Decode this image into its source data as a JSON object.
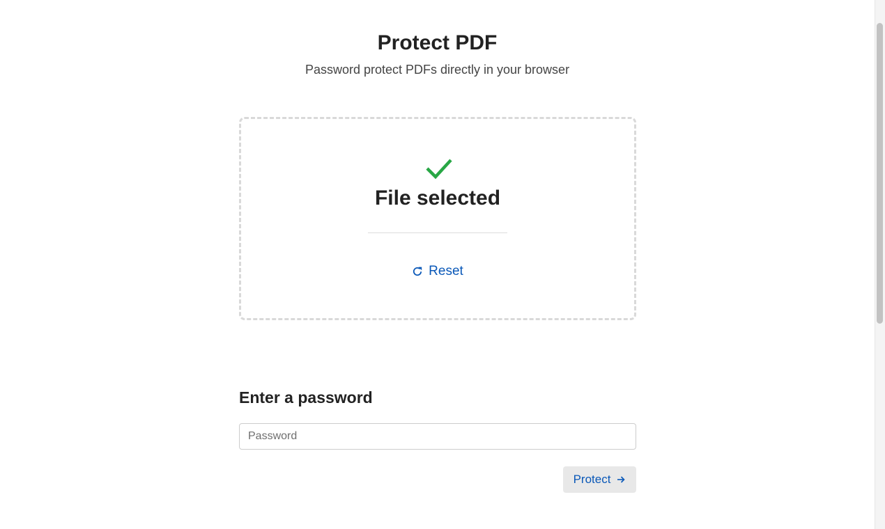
{
  "header": {
    "title": "Protect PDF",
    "subtitle": "Password protect PDFs directly in your browser"
  },
  "dropzone": {
    "status_icon": "checkmark-icon",
    "status_text": "File selected",
    "reset_icon": "refresh-icon",
    "reset_label": "Reset"
  },
  "password_section": {
    "heading": "Enter a password",
    "input_value": "",
    "input_placeholder": "Password",
    "submit_label": "Protect",
    "submit_icon": "arrow-right-icon"
  },
  "colors": {
    "accent": "#0a58b8",
    "success": "#28a745",
    "button_bg": "#e8e8e8",
    "dropzone_border": "#d9d9d9"
  }
}
